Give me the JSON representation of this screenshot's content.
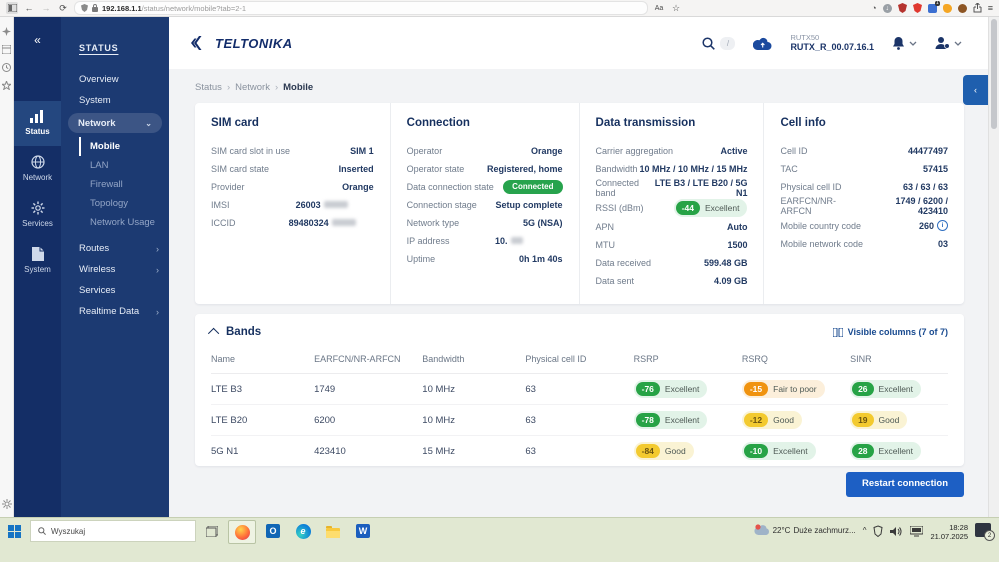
{
  "colors": {
    "sidebar_navy": "#1c3a72",
    "rail_navy": "#142e66",
    "brand_navy": "#132d6b",
    "status_green": "#27a346",
    "status_orange": "#f0930f",
    "status_yellow": "#f3ca2f",
    "link_blue": "#17498f",
    "button_blue": "#1d5fc4",
    "taskbar_green": "#e1e8d2"
  },
  "browser": {
    "url_host": "192.168.1.1",
    "url_rest": "/status/network/mobile?tab=2-1"
  },
  "app_header": {
    "brand": "TELTONIKA",
    "search_shortcut": "/",
    "model": "RUTX50",
    "firmware": "RUTX_R_00.07.16.1"
  },
  "nav_rail": {
    "collapse": "«",
    "items": [
      {
        "label": "Status"
      },
      {
        "label": "Network"
      },
      {
        "label": "Services"
      },
      {
        "label": "System"
      }
    ]
  },
  "nav_panel": {
    "title": "STATUS",
    "overview": "Overview",
    "system": "System",
    "network": "Network",
    "mobile": "Mobile",
    "lan": "LAN",
    "firewall": "Firewall",
    "topology": "Topology",
    "network_usage": "Network Usage",
    "routes": "Routes",
    "wireless": "Wireless",
    "services": "Services",
    "realtime_data": "Realtime Data"
  },
  "breadcrumb": {
    "s0": "Status",
    "s1": "Network",
    "s2": "Mobile"
  },
  "sim": {
    "title": "SIM card",
    "rows": [
      {
        "label": "SIM card slot in use",
        "value": "SIM 1"
      },
      {
        "label": "SIM card state",
        "value": "Inserted"
      },
      {
        "label": "Provider",
        "value": "Orange"
      },
      {
        "label": "IMSI",
        "value": "26003"
      },
      {
        "label": "ICCID",
        "value": "89480324"
      }
    ]
  },
  "connection": {
    "title": "Connection",
    "rows": [
      {
        "label": "Operator",
        "value": "Orange"
      },
      {
        "label": "Operator state",
        "value": "Registered, home"
      },
      {
        "label": "Data connection state",
        "value": "Connected"
      },
      {
        "label": "Connection stage",
        "value": "Setup complete"
      },
      {
        "label": "Network type",
        "value": "5G (NSA)"
      },
      {
        "label": "IP address",
        "value": "10."
      },
      {
        "label": "Uptime",
        "value": "0h 1m 40s"
      }
    ]
  },
  "data_transmission": {
    "title": "Data transmission",
    "rows": [
      {
        "label": "Carrier aggregation",
        "value": "Active"
      },
      {
        "label": "Bandwidth",
        "value": "10 MHz / 10 MHz / 15 MHz"
      },
      {
        "label": "Connected band",
        "value": "LTE B3 / LTE B20 / 5G N1"
      },
      {
        "label": "RSSI (dBm)",
        "badge": {
          "value": "-44",
          "label": "Excellent",
          "tone": "green"
        }
      },
      {
        "label": "APN",
        "value": "Auto"
      },
      {
        "label": "MTU",
        "value": "1500"
      },
      {
        "label": "Data received",
        "value": "599.48 GB"
      },
      {
        "label": "Data sent",
        "value": "4.09 GB"
      }
    ]
  },
  "cell_info": {
    "title": "Cell info",
    "rows": [
      {
        "label": "Cell ID",
        "value": "44477497"
      },
      {
        "label": "TAC",
        "value": "57415"
      },
      {
        "label": "Physical cell ID",
        "value": "63 / 63 / 63"
      },
      {
        "label": "EARFCN/NR-ARFCN",
        "value": "1749 / 6200 / 423410"
      },
      {
        "label": "Mobile country code",
        "value": "260"
      },
      {
        "label": "Mobile network code",
        "value": "03"
      }
    ]
  },
  "bands": {
    "title": "Bands",
    "visible_columns": "Visible columns (7 of 7)",
    "columns": [
      "Name",
      "EARFCN/NR-ARFCN",
      "Bandwidth",
      "Physical cell ID",
      "RSRP",
      "RSRQ",
      "SINR"
    ],
    "rows": [
      {
        "name": "LTE B3",
        "earfcn": "1749",
        "bandwidth": "10 MHz",
        "pci": "63",
        "rsrp": {
          "value": "-76",
          "label": "Excellent",
          "tone": "green"
        },
        "rsrq": {
          "value": "-15",
          "label": "Fair to poor",
          "tone": "orange"
        },
        "sinr": {
          "value": "26",
          "label": "Excellent",
          "tone": "green"
        }
      },
      {
        "name": "LTE B20",
        "earfcn": "6200",
        "bandwidth": "10 MHz",
        "pci": "63",
        "rsrp": {
          "value": "-78",
          "label": "Excellent",
          "tone": "green"
        },
        "rsrq": {
          "value": "-12",
          "label": "Good",
          "tone": "yellow"
        },
        "sinr": {
          "value": "19",
          "label": "Good",
          "tone": "yellow"
        }
      },
      {
        "name": "5G N1",
        "earfcn": "423410",
        "bandwidth": "15 MHz",
        "pci": "63",
        "rsrp": {
          "value": "-84",
          "label": "Good",
          "tone": "yellow"
        },
        "rsrq": {
          "value": "-10",
          "label": "Excellent",
          "tone": "green"
        },
        "sinr": {
          "value": "28",
          "label": "Excellent",
          "tone": "green"
        }
      }
    ]
  },
  "actions": {
    "restart": "Restart connection"
  },
  "taskbar": {
    "search": "Wyszukaj",
    "weather_temp": "22°C",
    "weather_desc": "Duże zachmurz...",
    "hidden_icons_caret": "^",
    "time": "18:28",
    "date": "21.07.2025",
    "notif_count": "2"
  }
}
